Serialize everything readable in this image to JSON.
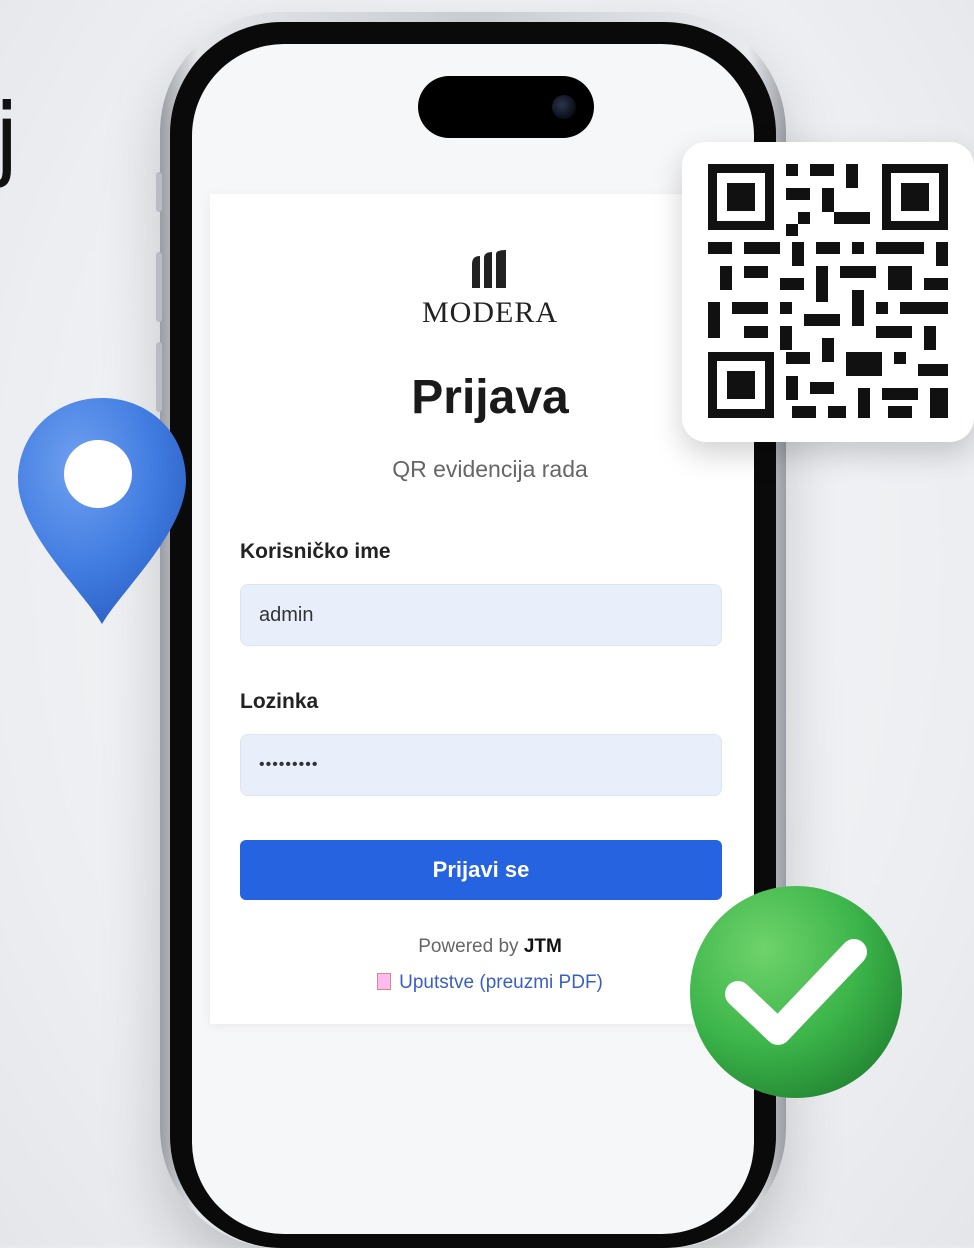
{
  "login": {
    "logo_text": "MODERA",
    "title": "Prijava",
    "subtitle": "QR evidencija rada",
    "username_label": "Korisničko ime",
    "username_value": "admin",
    "password_label": "Lozinka",
    "password_value": "•••••••••",
    "submit_label": "Prijavi se",
    "powered_prefix": "Powered by ",
    "powered_brand": "JTM",
    "manual_link": "Uputstve (preuzmi PDF)"
  },
  "decor": {
    "corner_glyph": "j",
    "pin_icon": "location-pin-icon",
    "qr_icon": "qr-code-icon",
    "check_icon": "check-circle-icon"
  },
  "colors": {
    "accent": "#2563e0",
    "pin": "#3f7be0",
    "check": "#3cb54a"
  }
}
